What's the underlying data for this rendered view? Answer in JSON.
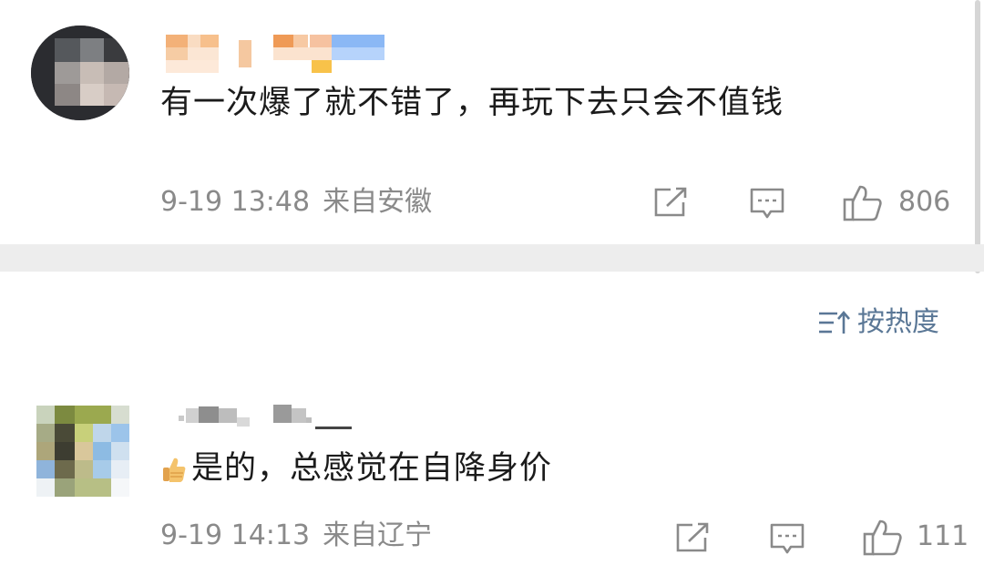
{
  "comments": [
    {
      "text": "有一次爆了就不错了，再玩下去只会不值钱",
      "time": "9-19 13:48",
      "location": "来自安徽",
      "likes": "806"
    },
    {
      "emoji": "thumbs-up",
      "text": "是的，总感觉在自降身价",
      "time": "9-19 14:13",
      "location": "来自辽宁",
      "likes": "111"
    }
  ],
  "sort": {
    "label": "按热度"
  },
  "icons": {
    "repost": "share-icon",
    "comment": "comment-icon",
    "like": "like-icon",
    "sort": "sort-icon"
  },
  "colors": {
    "sort_accent": "#5a7796",
    "meta_text": "#8a8a8a",
    "body_text": "#1b1b1b",
    "divider": "#ededed"
  }
}
